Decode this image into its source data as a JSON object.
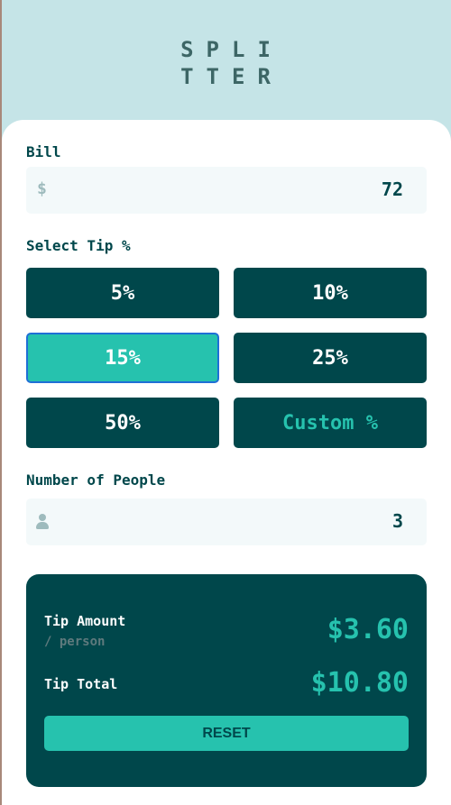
{
  "logo": {
    "line1": "SPLI",
    "line2": "TTER"
  },
  "bill": {
    "label": "Bill",
    "currency_icon": "$",
    "value": "72"
  },
  "tip": {
    "label": "Select Tip %",
    "options": [
      "5%",
      "10%",
      "15%",
      "25%",
      "50%"
    ],
    "selected": "15%",
    "custom_placeholder": "Custom %"
  },
  "people": {
    "label": "Number of People",
    "icon": "person-icon",
    "value": "3"
  },
  "result": {
    "tip_amount_label": "Tip Amount",
    "per_person_label": "/ person",
    "tip_amount_value": "$3.60",
    "tip_total_label": "Tip Total",
    "tip_total_value": "$10.80",
    "reset_label": "RESET"
  },
  "colors": {
    "background": "#c5e4e7",
    "dark_cyan": "#00474b",
    "strong_cyan": "#26c2ae",
    "input_bg": "#f3f9fa"
  }
}
